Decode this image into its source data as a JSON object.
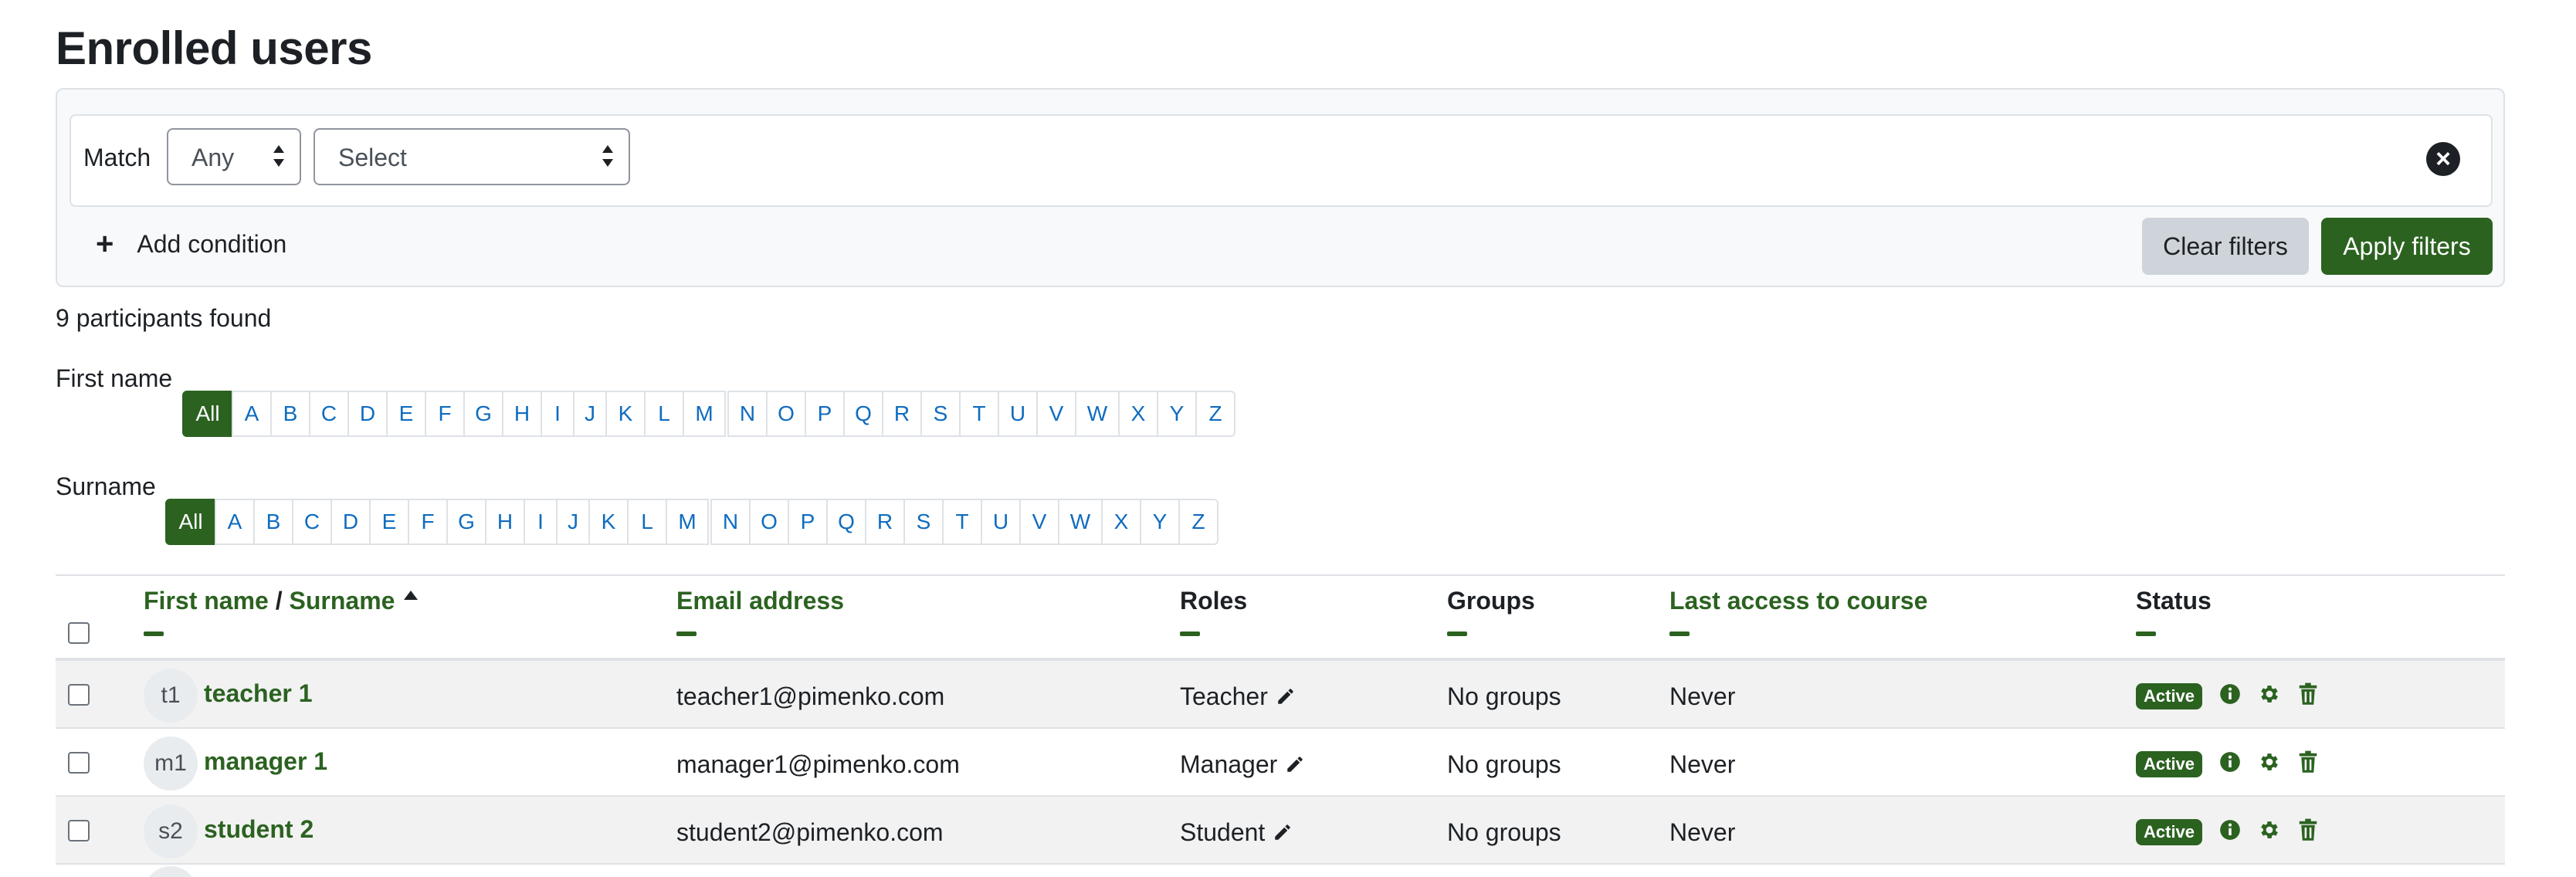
{
  "page": {
    "title": "Enrolled users"
  },
  "filters": {
    "match_label": "Match",
    "match_value": "Any",
    "field_value": "Select",
    "add_condition_label": "Add condition",
    "clear_label": "Clear filters",
    "apply_label": "Apply filters"
  },
  "participants_found": "9 participants found",
  "initials": {
    "firstname_label": "First name",
    "surname_label": "Surname",
    "all_label": "All",
    "group1": [
      "A",
      "B",
      "C",
      "D",
      "E",
      "F",
      "G",
      "H",
      "I",
      "J",
      "K",
      "L",
      "M"
    ],
    "group2": [
      "N",
      "O",
      "P",
      "Q",
      "R",
      "S",
      "T",
      "U",
      "V",
      "W",
      "X",
      "Y",
      "Z"
    ]
  },
  "table": {
    "headers": {
      "firstname": "First name",
      "separator": " / ",
      "surname": "Surname",
      "email": "Email address",
      "roles": "Roles",
      "groups": "Groups",
      "last_access": "Last access to course",
      "status": "Status"
    },
    "rows": [
      {
        "initials": "t1",
        "name": "teacher 1",
        "email": "teacher1@pimenko.com",
        "role": "Teacher",
        "groups": "No groups",
        "last_access": "Never",
        "status": "Active"
      },
      {
        "initials": "m1",
        "name": "manager 1",
        "email": "manager1@pimenko.com",
        "role": "Manager",
        "groups": "No groups",
        "last_access": "Never",
        "status": "Active"
      },
      {
        "initials": "s2",
        "name": "student 2",
        "email": "student2@pimenko.com",
        "role": "Student",
        "groups": "No groups",
        "last_access": "Never",
        "status": "Active"
      }
    ]
  },
  "icons": {
    "remove_condition": "close-circle-icon",
    "add_condition": "plus-icon",
    "sort": "sort-ascending-icon",
    "edit_role": "pencil-icon",
    "info": "info-icon",
    "settings": "gear-icon",
    "delete": "trash-icon"
  },
  "colors": {
    "brand_green": "#2b6220",
    "link_blue": "#0f6cbf"
  }
}
